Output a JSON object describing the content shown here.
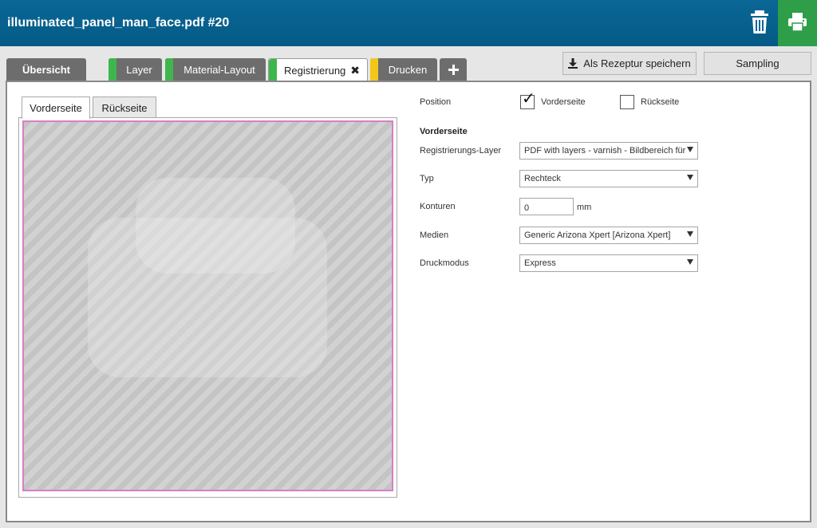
{
  "titlebar": {
    "title": "illuminated_panel_man_face.pdf #20",
    "delete_icon": "trash-icon",
    "print_icon": "printer-icon"
  },
  "tabs": [
    {
      "label": "Übersicht"
    },
    {
      "label": "Layer",
      "status_color": "#3fb64c"
    },
    {
      "label": "Material-Layout",
      "status_color": "#3fb64c"
    },
    {
      "label": "Registrierung",
      "status_color": "#3fb64c",
      "active": true
    },
    {
      "label": "Drucken",
      "status_color": "#f3c61c"
    }
  ],
  "add_tab_icon": "plus-icon",
  "toolbar": {
    "save_recipe_label": "Als Rezeptur speichern",
    "sampling_label": "Sampling"
  },
  "preview": {
    "tabs": [
      "Vorderseite",
      "Rückseite"
    ],
    "active_tab": "Vorderseite"
  },
  "form": {
    "position_label": "Position",
    "position_front": {
      "label": "Vorderseite",
      "checked": true
    },
    "position_back": {
      "label": "Rückseite",
      "checked": false
    },
    "section_title": "Vorderseite",
    "registration_layer": {
      "label": "Registrierungs-Layer",
      "value": "PDF with layers - varnish - Bildbereich für"
    },
    "type": {
      "label": "Typ",
      "value": "Rechteck"
    },
    "contours": {
      "label": "Konturen",
      "value": "0",
      "unit": "mm"
    },
    "media": {
      "label": "Medien",
      "value": "Generic Arizona Xpert [Arizona Xpert]"
    },
    "print_mode": {
      "label": "Druckmodus",
      "value": "Express"
    }
  },
  "colors": {
    "titlebar": "#055a86",
    "print_button": "#2e9e48",
    "status_green": "#3fb64c",
    "status_yellow": "#f3c61c",
    "preview_border": "#d77fc6"
  }
}
